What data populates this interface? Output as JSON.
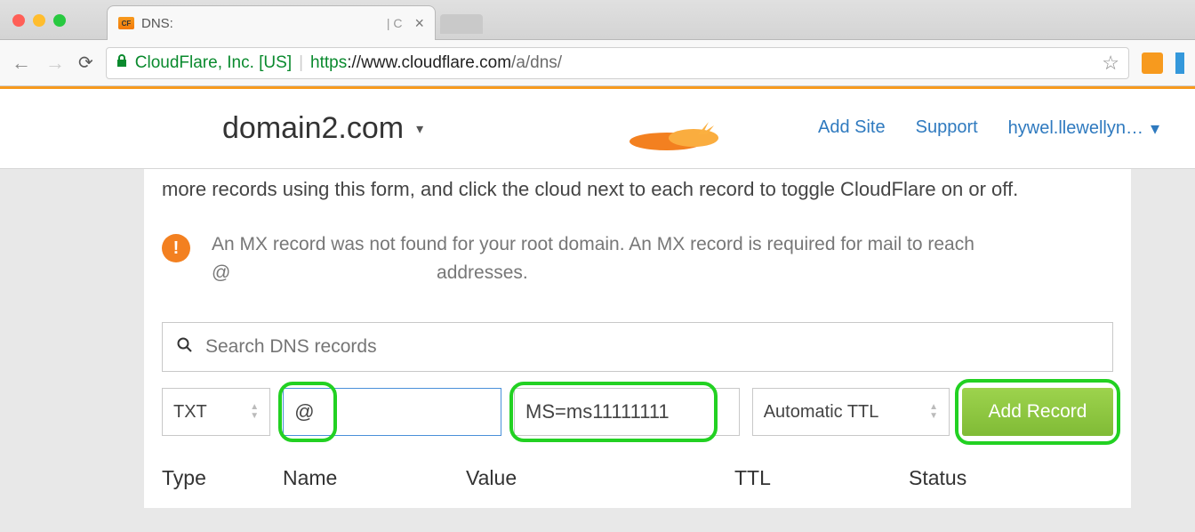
{
  "browser": {
    "tab_title": "DNS:",
    "ev_name": "CloudFlare, Inc. [US]",
    "url_proto": "https",
    "url_host": "://www.cloudflare.com",
    "url_path": "/a/dns/"
  },
  "header": {
    "domain": "domain2.com",
    "nav": {
      "add_site": "Add Site",
      "support": "Support",
      "user": "hywel.llewellyn…"
    }
  },
  "content": {
    "intro": "more records using this form, and click the cloud next to each record to toggle CloudFlare on or off.",
    "warning_line1": "An MX record was not found for your root domain. An MX record is required for mail to reach",
    "warning_line2_prefix": "@",
    "warning_line2_suffix": "addresses.",
    "search_placeholder": "Search DNS records"
  },
  "add_record": {
    "type": "TXT",
    "name": "@",
    "value": "MS=ms11111111",
    "ttl": "Automatic TTL",
    "button": "Add Record"
  },
  "table": {
    "headers": {
      "type": "Type",
      "name": "Name",
      "value": "Value",
      "ttl": "TTL",
      "status": "Status"
    }
  }
}
